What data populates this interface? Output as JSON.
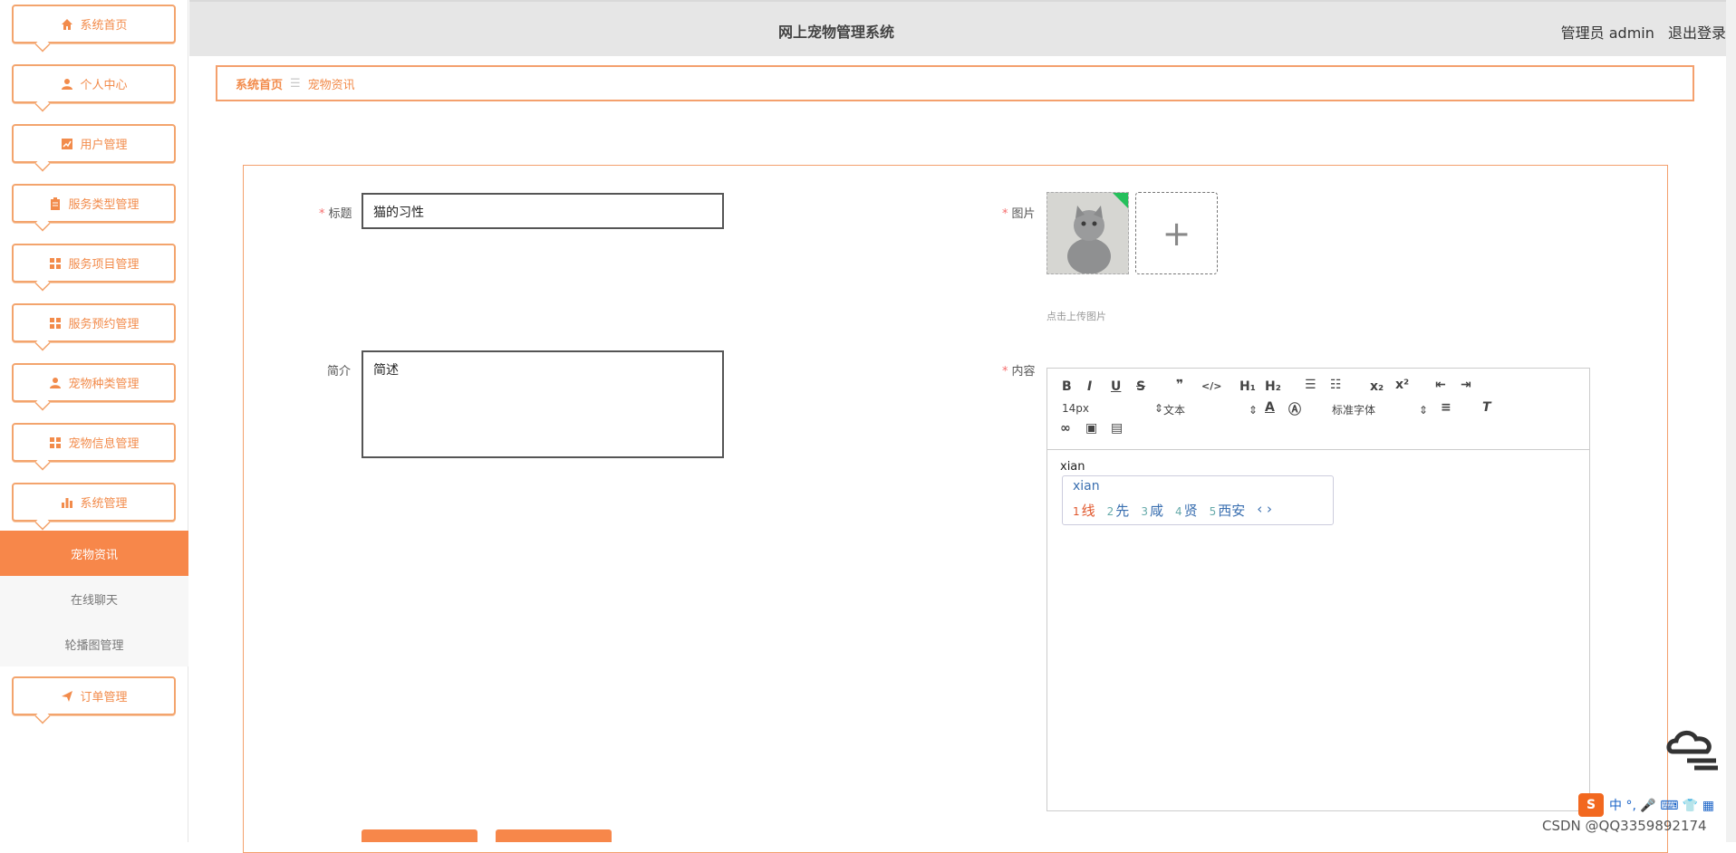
{
  "sidebar": {
    "items": [
      {
        "label": "系统首页",
        "icon": "home-icon"
      },
      {
        "label": "个人中心",
        "icon": "user-icon"
      },
      {
        "label": "用户管理",
        "icon": "chart-icon"
      },
      {
        "label": "服务类型管理",
        "icon": "clipboard-icon"
      },
      {
        "label": "服务项目管理",
        "icon": "grid-icon"
      },
      {
        "label": "服务预约管理",
        "icon": "grid-icon"
      },
      {
        "label": "宠物种类管理",
        "icon": "user-icon"
      },
      {
        "label": "宠物信息管理",
        "icon": "grid-icon"
      },
      {
        "label": "系统管理",
        "icon": "bar-chart-icon"
      }
    ],
    "submenu": [
      "宠物资讯",
      "在线聊天",
      "轮播图管理"
    ],
    "last_item": {
      "label": "订单管理",
      "icon": "send-icon"
    }
  },
  "header": {
    "title": "网上宠物管理系统",
    "role": "管理员 admin",
    "logout": "退出登录"
  },
  "breadcrumb": {
    "home": "系统首页",
    "sep": "☰",
    "current": "宠物资讯"
  },
  "form": {
    "title_label": "标题",
    "title_value": "猫的习性",
    "intro_label": "简介",
    "intro_value": "简述",
    "image_label": "图片",
    "upload_hint": "点击上传图片",
    "content_label": "内容",
    "content_text": "xian"
  },
  "editor": {
    "font_size": "14px",
    "text_type": "文本",
    "font_family": "标准字体"
  },
  "ime": {
    "pinyin": "xian",
    "candidates": [
      {
        "num": "1",
        "word": "线"
      },
      {
        "num": "2",
        "word": "先"
      },
      {
        "num": "3",
        "word": "咸"
      },
      {
        "num": "4",
        "word": "贤"
      },
      {
        "num": "5",
        "word": "西安"
      }
    ],
    "tray": "中 °, 🎤 ⌨ 👕 ▦"
  },
  "watermark": "CSDN @QQ3359892174",
  "colors": {
    "accent": "#f7874a",
    "border": "#f4a06d"
  }
}
